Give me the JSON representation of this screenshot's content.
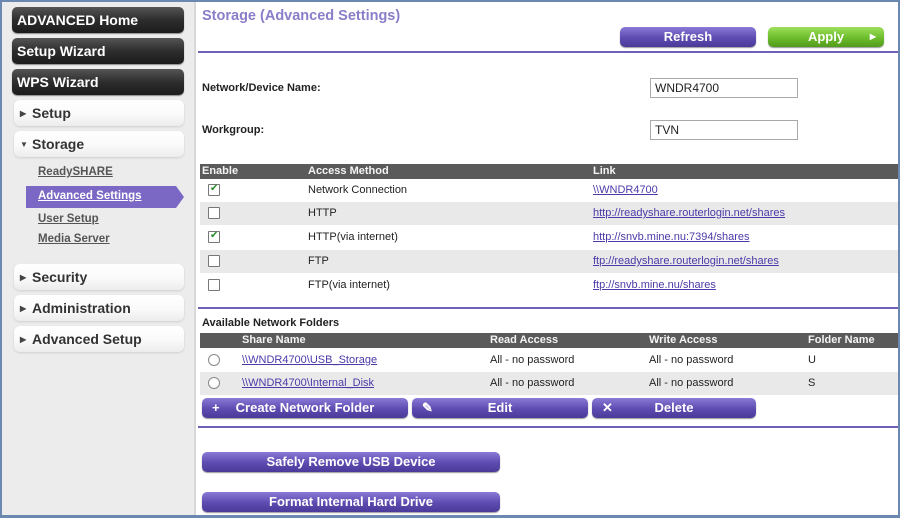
{
  "sidebar": {
    "top_buttons": [
      "ADVANCED Home",
      "Setup Wizard",
      "WPS Wizard"
    ],
    "sections": [
      {
        "label": "Setup",
        "expanded": false
      },
      {
        "label": "Storage",
        "expanded": true
      },
      {
        "label": "Security",
        "expanded": false
      },
      {
        "label": "Administration",
        "expanded": false
      },
      {
        "label": "Advanced Setup",
        "expanded": false
      }
    ],
    "storage_items": [
      "ReadySHARE",
      "Advanced Settings",
      "User Setup",
      "Media Server"
    ],
    "active_item": "Advanced Settings"
  },
  "main": {
    "title": "Storage (Advanced Settings)",
    "refresh_label": "Refresh",
    "apply_label": "Apply",
    "device_name_label": "Network/Device Name:",
    "device_name_value": "WNDR4700",
    "workgroup_label": "Workgroup:",
    "workgroup_value": "TVN",
    "access_table": {
      "headers": [
        "Enable",
        "Access Method",
        "Link"
      ],
      "rows": [
        {
          "enabled": true,
          "method": "Network Connection",
          "link": "\\\\WNDR4700"
        },
        {
          "enabled": false,
          "method": "HTTP",
          "link": "http://readyshare.routerlogin.net/shares"
        },
        {
          "enabled": true,
          "method": "HTTP(via internet)",
          "link": "http://snvb.mine.nu:7394/shares"
        },
        {
          "enabled": false,
          "method": "FTP",
          "link": "ftp://readyshare.routerlogin.net/shares"
        },
        {
          "enabled": false,
          "method": "FTP(via internet)",
          "link": "ftp://snvb.mine.nu/shares"
        }
      ]
    },
    "folders_label": "Available Network Folders",
    "folders_table": {
      "headers": [
        "Share Name",
        "Read Access",
        "Write Access",
        "Folder Name"
      ],
      "rows": [
        {
          "share": "\\\\WNDR4700\\USB_Storage",
          "read": "All - no password",
          "write": "All - no password",
          "folder": "U"
        },
        {
          "share": "\\\\WNDR4700\\Internal_Disk",
          "read": "All - no password",
          "write": "All - no password",
          "folder": "S"
        }
      ]
    },
    "create_folder_label": "Create Network Folder",
    "edit_label": "Edit",
    "delete_label": "Delete",
    "safely_remove_label": "Safely Remove USB Device",
    "format_label": "Format Internal Hard Drive"
  },
  "colors": {
    "accent_purple": "#5d4bb0",
    "apply_green": "#6cbc2c",
    "title_purple": "#8b7dc8",
    "table_header": "#5a5a5a"
  }
}
